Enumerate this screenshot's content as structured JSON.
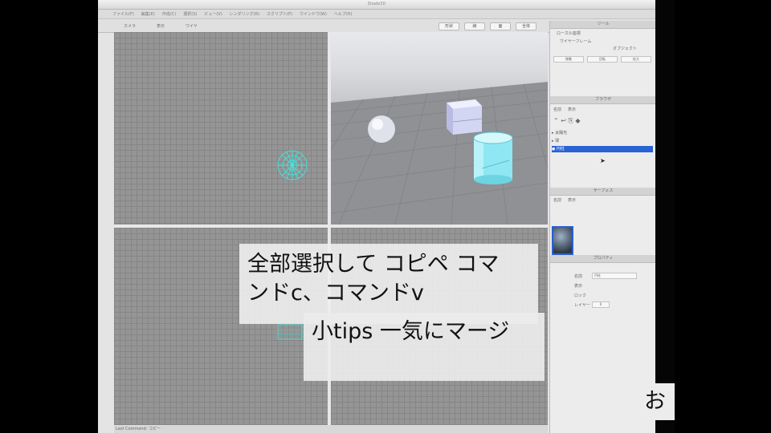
{
  "window": {
    "title": "Shade3D"
  },
  "menubar": {
    "items": [
      "ファイル(F)",
      "編集(E)",
      "作成(C)",
      "選択(S)",
      "ビュー(V)",
      "レンダリング(R)",
      "スクリプト(P)",
      "ウインドウ(W)",
      "ヘルプ(H)"
    ]
  },
  "toolbar": {
    "left": [
      "カメラ",
      "表示",
      "ワイヤ"
    ],
    "right": [
      "形状",
      "線",
      "面",
      "全体"
    ]
  },
  "panel": {
    "section1_title": "ツール",
    "section1_labels": [
      "ローカル座標",
      "ワイヤーフレーム",
      "オブジェクト"
    ],
    "section1_buttons": [
      "移動",
      "回転",
      "拡大"
    ],
    "browser_title": "ブラウザ",
    "browser_tabs": [
      "名前",
      "表示"
    ],
    "browser_items": [
      "太陽光",
      "球",
      "円柱"
    ],
    "surface_title": "サーフェス",
    "surface_tabs": [
      "名前",
      "表示"
    ],
    "properties_title": "プロパティ",
    "properties_rows": [
      "名前",
      "表示",
      "ロック",
      "レイヤー"
    ],
    "properties_values": [
      "円柱",
      "",
      "",
      "0"
    ]
  },
  "status": {
    "text": "Last Command: コピー"
  },
  "captions": {
    "line1": "全部選択して コピペ コマ",
    "line2": "ンドc、コマンドv",
    "line3": "小tips 一気にマージ",
    "line4": "お"
  },
  "colors": {
    "selection": "#2a63d4",
    "highlight": "#3ee7e0"
  }
}
